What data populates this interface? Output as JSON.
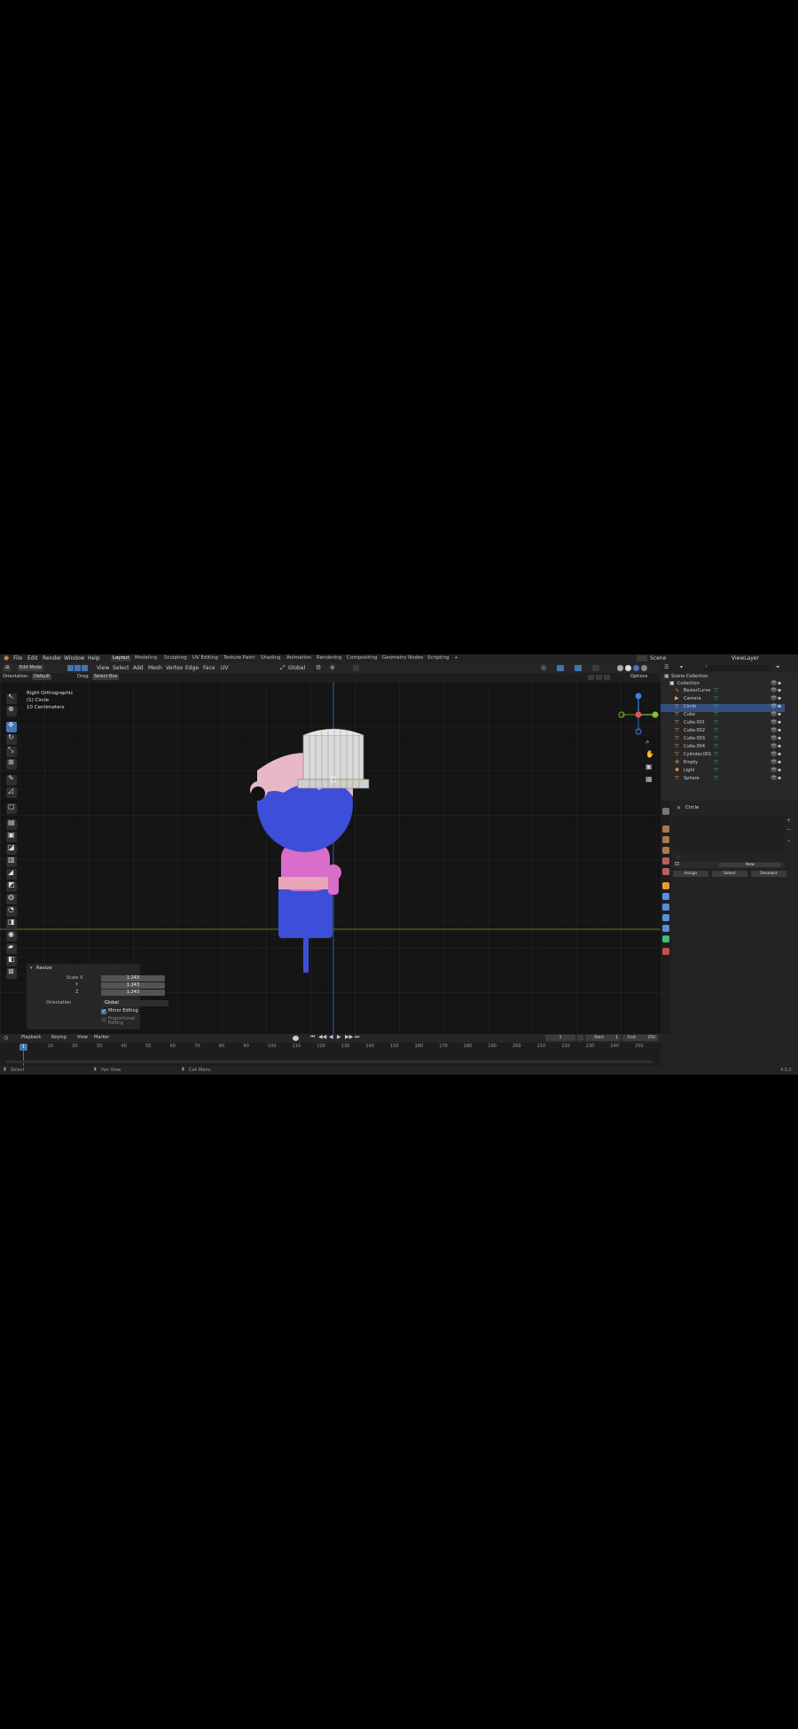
{
  "menu": {
    "items": [
      "File",
      "Edit",
      "Render",
      "Window",
      "Help"
    ],
    "workspaces": [
      "Layout",
      "Modeling",
      "Sculpting",
      "UV Editing",
      "Texture Paint",
      "Shading",
      "Animation",
      "Rendering",
      "Compositing",
      "Geometry Nodes",
      "Scripting"
    ],
    "active_workspace": "Layout",
    "plus": "+",
    "scene_label": "Scene",
    "view_layer_label": "ViewLayer"
  },
  "header": {
    "mode": "Edit Mode",
    "menus": [
      "View",
      "Select",
      "Add",
      "Mesh",
      "Vertex",
      "Edge",
      "Face",
      "UV"
    ],
    "transform_orientation": "Global",
    "options": "Options"
  },
  "tool_settings": {
    "orientation_label": "Orientation:",
    "orientation_value": "Default",
    "drag_label": "Drag:",
    "drag_value": "Select Box"
  },
  "viewport": {
    "view_name": "Right Orthographic",
    "object_name": "(1) Circle",
    "units": "10 Centimeters"
  },
  "operator_panel": {
    "title": "Resize",
    "scale_label": "Scale X",
    "y_label": "Y",
    "z_label": "Z",
    "scale_x": "1.243",
    "scale_y": "1.243",
    "scale_z": "1.243",
    "orientation_label": "Orientation",
    "orientation_value": "Global",
    "mirror_editing": "Mirror Editing",
    "proportional_editing": "Proportional Editing"
  },
  "outliner": {
    "scene_collection": "Scene Collection",
    "collection": "Collection",
    "items": [
      "BezierCurve",
      "Camera",
      "Circle",
      "Cube",
      "Cube.001",
      "Cube.002",
      "Cube.003",
      "Cube.004",
      "Cylinder.001",
      "Empty",
      "Light",
      "Sphere"
    ],
    "selected": "Circle"
  },
  "properties": {
    "object_name": "Circle",
    "buttons": [
      "Assign",
      "Select",
      "Deselect"
    ],
    "new_label": "New"
  },
  "timeline": {
    "menus": [
      "Playback",
      "Keying",
      "View",
      "Marker"
    ],
    "current_frame": "1",
    "start_label": "Start",
    "start_value": "1",
    "end_label": "End",
    "end_value": "250",
    "ticks": [
      "1",
      "10",
      "20",
      "30",
      "40",
      "50",
      "60",
      "70",
      "80",
      "90",
      "100",
      "110",
      "120",
      "130",
      "140",
      "150",
      "160",
      "170",
      "180",
      "190",
      "200",
      "210",
      "220",
      "230",
      "240",
      "250"
    ]
  },
  "statusbar": {
    "items": [
      "Select",
      "Pan View",
      "Call Menu"
    ],
    "version": "4.0.2"
  },
  "colors": {
    "accent": "#4772b3",
    "body_blue": "#3d4fd9",
    "pink": "#d86ec9",
    "face_pink": "#e8b8c8",
    "hat": "#d9d9d9",
    "axis_x": "#e8525a",
    "axis_y": "#7ec22a",
    "axis_z": "#3d7fe0"
  }
}
